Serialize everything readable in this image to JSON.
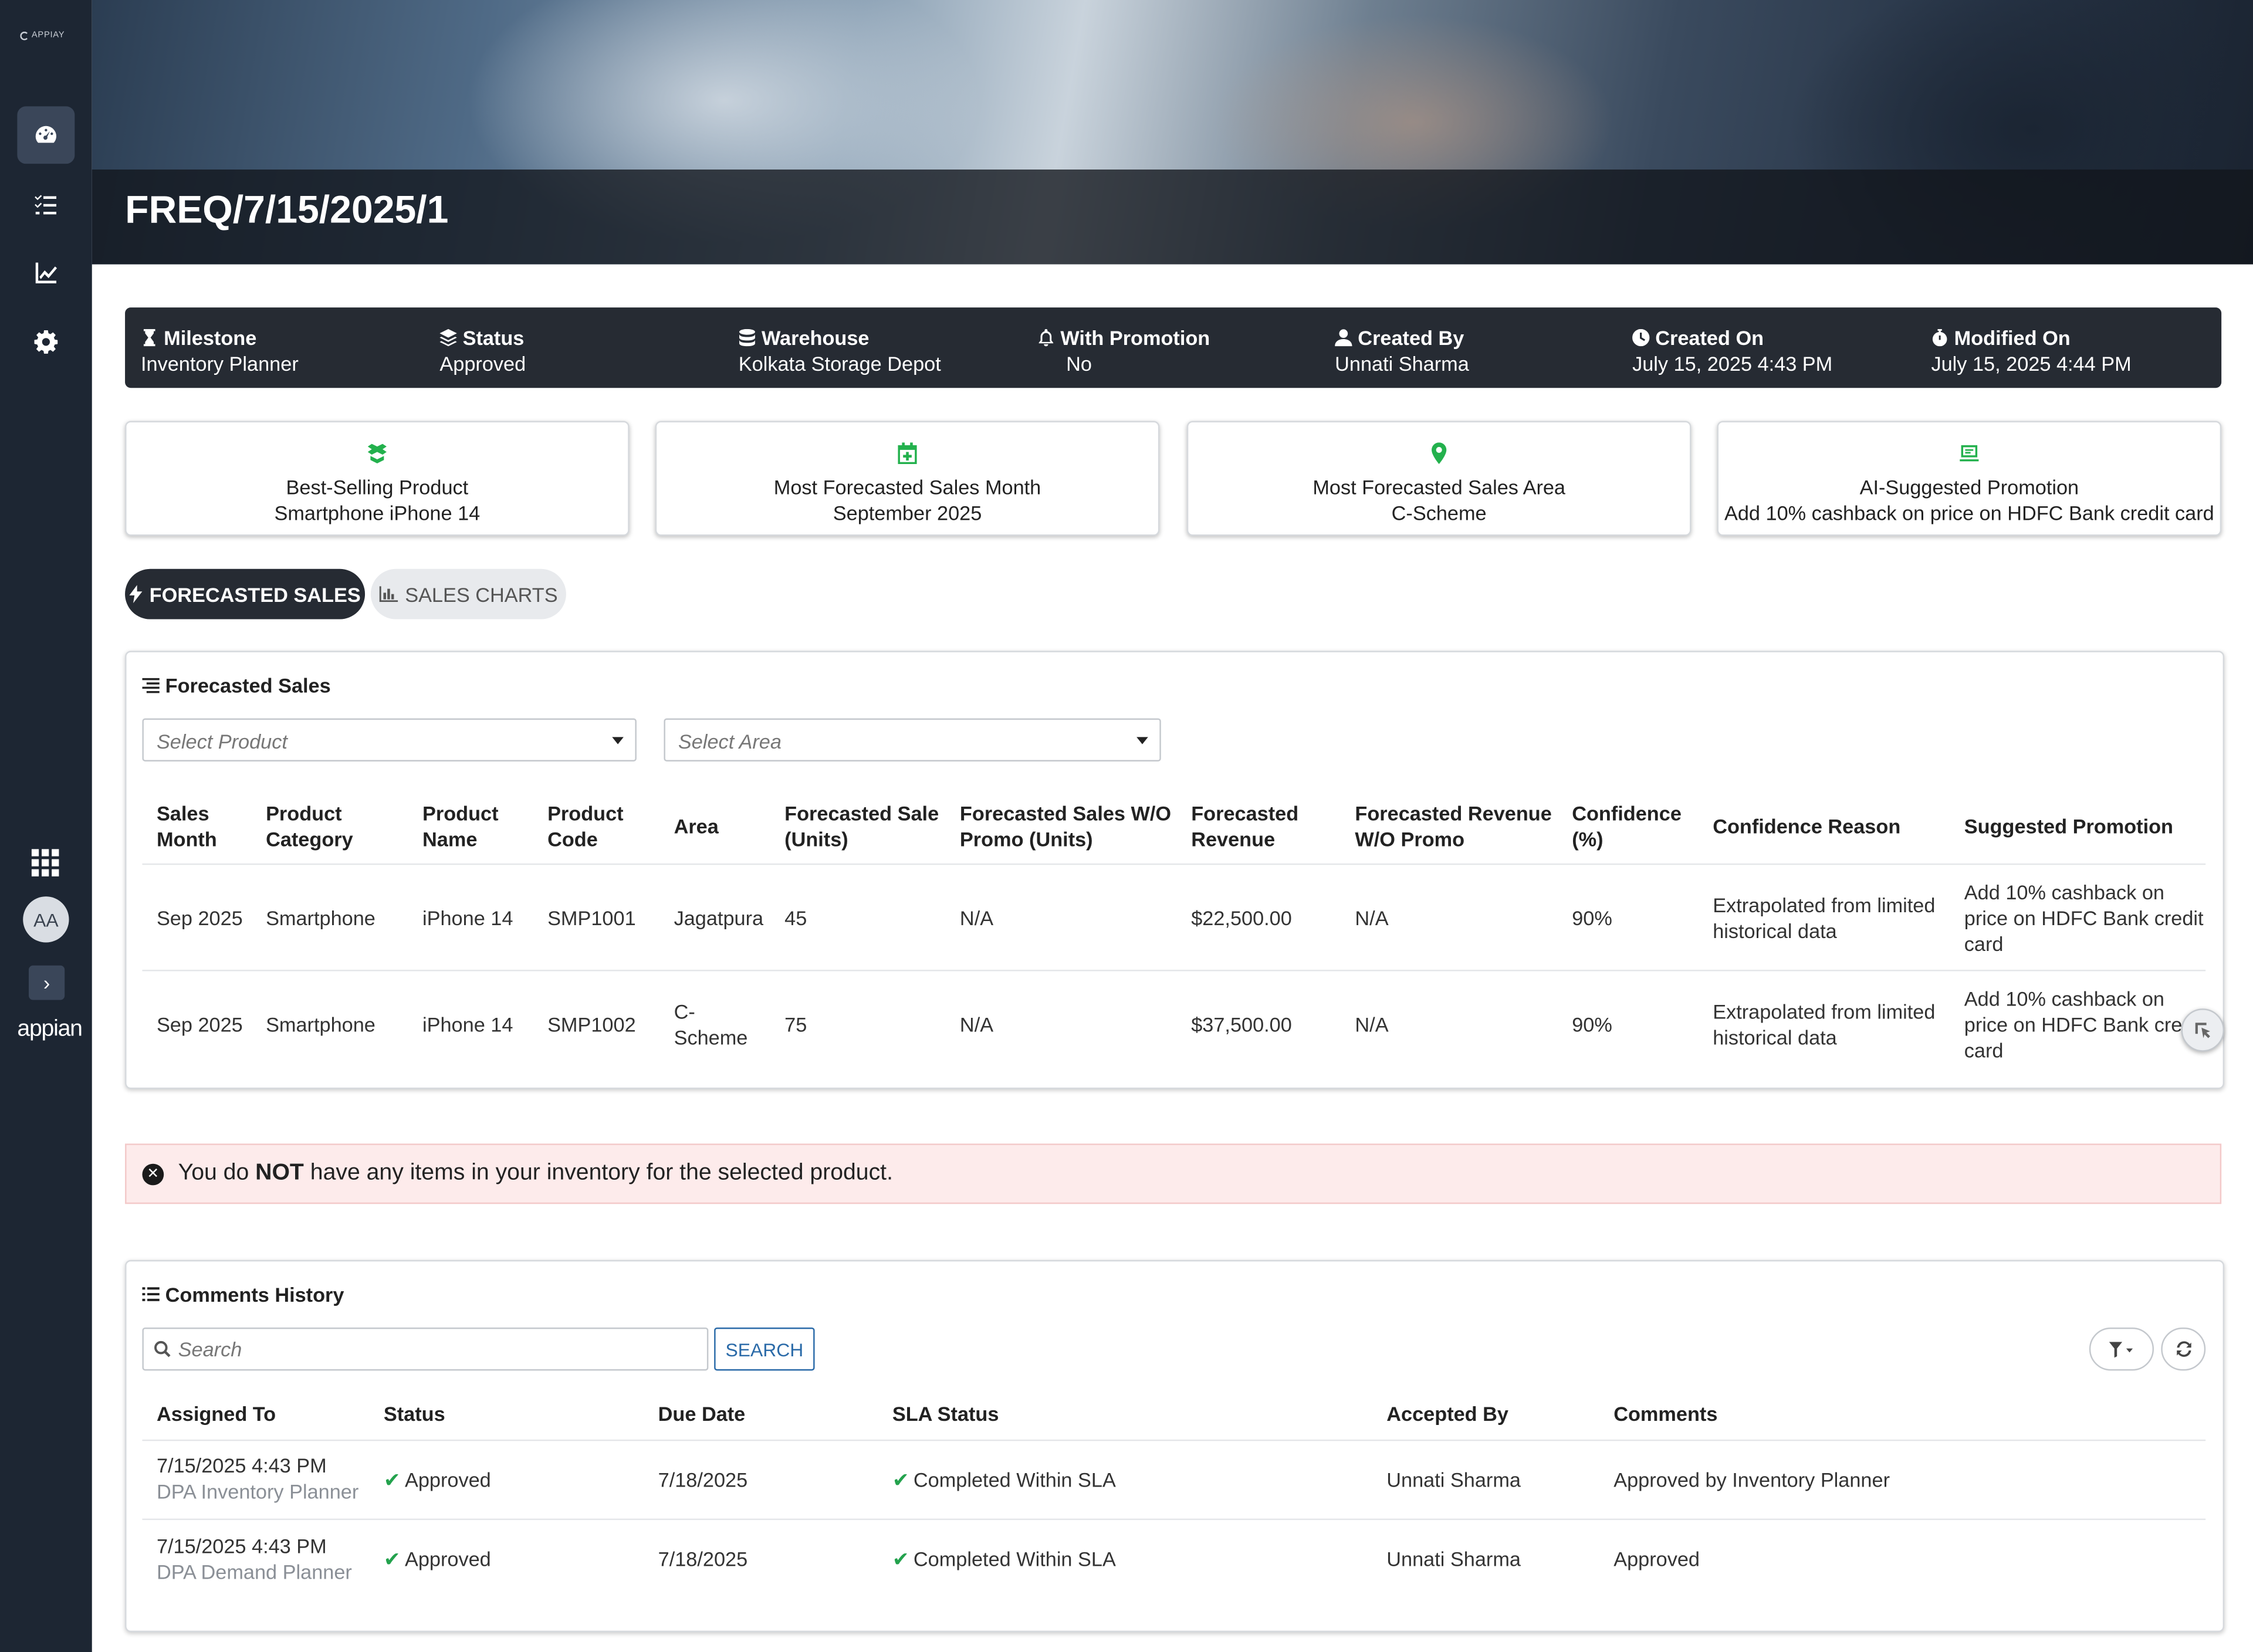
{
  "sidebar": {
    "logo_text": "APPIAY",
    "avatar_initials": "AA",
    "brand": "appian",
    "nav_icons": [
      "dashboard-icon",
      "tasks-list-icon",
      "analytics-chart-icon",
      "settings-gear-icon"
    ]
  },
  "header": {
    "title": "FREQ/7/15/2025/1"
  },
  "info_bar": {
    "items": [
      {
        "label": "Milestone",
        "value": "Inventory Planner",
        "icon": "hourglass-icon"
      },
      {
        "label": "Status",
        "value": "Approved",
        "icon": "layers-icon"
      },
      {
        "label": "Warehouse",
        "value": "Kolkata Storage Depot",
        "icon": "database-icon"
      },
      {
        "label": "With Promotion",
        "value": "No",
        "icon": "bell-icon"
      },
      {
        "label": "Created By",
        "value": "Unnati Sharma",
        "icon": "user-icon"
      },
      {
        "label": "Created On",
        "value": "July 15, 2025 4:43 PM",
        "icon": "clock-icon"
      },
      {
        "label": "Modified On",
        "value": "July 15, 2025 4:44 PM",
        "icon": "stopwatch-icon"
      }
    ]
  },
  "kpi_cards": [
    {
      "title": "Best-Selling Product",
      "value": "Smartphone iPhone 14",
      "icon": "box-icon"
    },
    {
      "title": "Most Forecasted Sales Month",
      "value": "September 2025",
      "icon": "calendar-plus-icon"
    },
    {
      "title": "Most Forecasted Sales Area",
      "value": "C-Scheme",
      "icon": "map-pin-icon"
    },
    {
      "title": "AI-Suggested Promotion",
      "value": "Add 10% cashback on price on HDFC Bank credit card",
      "icon": "ai-screen-icon"
    }
  ],
  "tabs": [
    {
      "label": "FORECASTED SALES",
      "active": true,
      "icon": "lightning-icon"
    },
    {
      "label": "SALES CHARTS",
      "active": false,
      "icon": "bar-chart-icon"
    }
  ],
  "forecast": {
    "title": "Forecasted Sales",
    "product_placeholder": "Select Product",
    "area_placeholder": "Select Area",
    "headers": [
      [
        "Sales",
        "Month"
      ],
      [
        "Product",
        "Category"
      ],
      [
        "Product",
        "Name"
      ],
      [
        "Product",
        "Code"
      ],
      [
        "Area"
      ],
      [
        "Forecasted Sale",
        "(Units)"
      ],
      [
        "Forecasted Sales W/O",
        "Promo (Units)"
      ],
      [
        "Forecasted",
        "Revenue"
      ],
      [
        "Forecasted Revenue",
        "W/O Promo"
      ],
      [
        "Confidence",
        "(%)"
      ],
      [
        "Confidence Reason"
      ],
      [
        "Suggested Promotion"
      ]
    ],
    "rows": [
      {
        "month": "Sep 2025",
        "category": "Smartphone",
        "name": "iPhone 14",
        "code": "SMP1001",
        "area": [
          "Jagatpura"
        ],
        "units": "45",
        "units_wo": "N/A",
        "revenue": "$22,500.00",
        "revenue_wo": "N/A",
        "confidence": "90%",
        "reason": [
          "Extrapolated from limited",
          "historical data"
        ],
        "promotion": [
          "Add 10% cashback on",
          "price on HDFC Bank credit",
          "card"
        ]
      },
      {
        "month": "Sep 2025",
        "category": "Smartphone",
        "name": "iPhone 14",
        "code": "SMP1002",
        "area": [
          "C-",
          "Scheme"
        ],
        "units": "75",
        "units_wo": "N/A",
        "revenue": "$37,500.00",
        "revenue_wo": "N/A",
        "confidence": "90%",
        "reason": [
          "Extrapolated from limited",
          "historical data"
        ],
        "promotion": [
          "Add 10% cashback on",
          "price on HDFC Bank credit",
          "card"
        ]
      }
    ]
  },
  "alert": {
    "prefix": "You do ",
    "emphasis": "NOT",
    "suffix": " have any items in your inventory for the selected product."
  },
  "comments": {
    "title": "Comments History",
    "search_placeholder": "Search",
    "search_button": "SEARCH",
    "headers": [
      "Assigned To",
      "Status",
      "Due Date",
      "SLA Status",
      "Accepted By",
      "Comments"
    ],
    "rows": [
      {
        "assigned": "7/15/2025 4:43 PM",
        "assigned_sub": "DPA Inventory Planner",
        "status": "Approved",
        "due": "7/18/2025",
        "sla": "Completed Within SLA",
        "accepted": "Unnati Sharma",
        "comment": "Approved by Inventory Planner"
      },
      {
        "assigned": "7/15/2025 4:43 PM",
        "assigned_sub": "DPA Demand Planner",
        "status": "Approved",
        "due": "7/18/2025",
        "sla": "Completed Within SLA",
        "accepted": "Unnati Sharma",
        "comment": "Approved"
      }
    ]
  },
  "colors": {
    "sidebar": "#1d2633",
    "infobar": "#262b33",
    "accent_green": "#23b14d",
    "link_blue": "#2a6aa8",
    "alert_bg": "#fdebeb"
  }
}
